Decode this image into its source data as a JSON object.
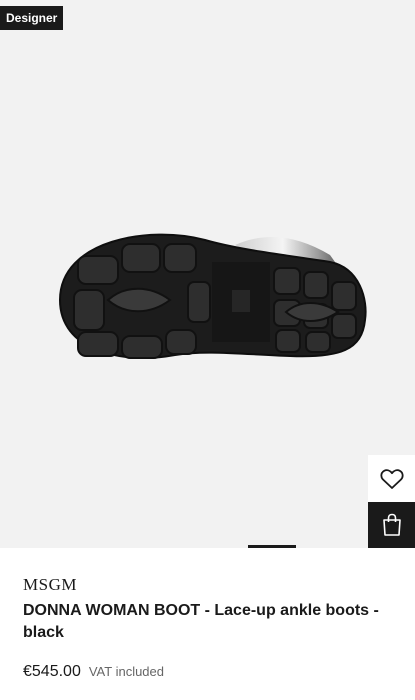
{
  "badge": {
    "label": "Designer"
  },
  "product": {
    "brand": "MSGM",
    "name": "DONNA WOMAN BOOT - Lace-up ankle boots - black",
    "price": "€545.00",
    "vat_note": "VAT included"
  },
  "actions": {
    "wishlist_icon": "heart-icon",
    "bag_icon": "shopping-bag-icon"
  },
  "carousel": {
    "total": 2,
    "active": 1
  },
  "colors": {
    "brand_dark": "#1a1a1a",
    "image_bg": "#f2f2f2"
  }
}
